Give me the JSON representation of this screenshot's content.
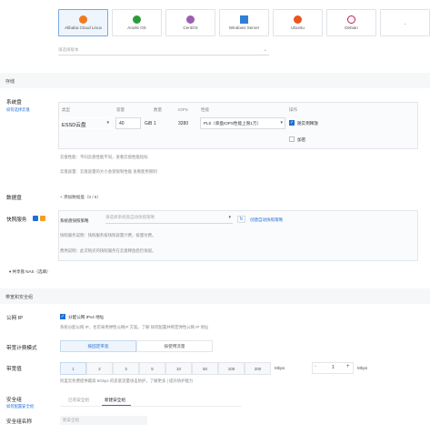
{
  "os_tabs": [
    {
      "name": "Alibaba Cloud Linux",
      "color": "#f07b1f",
      "selected": true
    },
    {
      "name": "Anolis OS",
      "color": "#2d9b3a",
      "selected": false
    },
    {
      "name": "CentOS",
      "color": "#9c5fb0",
      "selected": false
    },
    {
      "name": "Windows Server",
      "color": "#2f7fd6",
      "selected": false
    },
    {
      "name": "Ubuntu",
      "color": "#e95420",
      "selected": false
    },
    {
      "name": "Debian",
      "color": "#c7184f",
      "selected": false
    },
    {
      "name": "",
      "color": "#bbb",
      "selected": false
    }
  ],
  "version_select": {
    "placeholder": "请选择版本"
  },
  "storage": {
    "section_title": "存储",
    "system_disk_label": "系统盘",
    "system_disk_sub": "如何选择云盘",
    "headers": [
      "类型",
      "容量",
      "数量",
      "IOPS",
      "性能",
      "操作"
    ],
    "disk_type": "ESSD云盘",
    "capacity": "40",
    "unit": "GiB",
    "count": "1",
    "iops": "3280",
    "performance": "PL0（单盘IOPS性能上限1万）",
    "release_label": "随实例释放",
    "encrypt_label": "加密",
    "note1": "云盘性能：不同云盘性能不同，查看云盘性能指标",
    "note2": "云盘容量：云盘容量的大小会受限制性能 查看使用限制",
    "data_disk_label": "数据盘",
    "add_data_disk": "添加数据盘（0 / 6）",
    "snapshot_label": "快照服务",
    "snapshot_policy_label": "系统盘快照策略",
    "snapshot_policy_placeholder": "请选择系统盘自动快照策略",
    "create_policy": "创建自动快照策略",
    "snapshot_note1": "快照服务说明：快照服务按快照容量计费，按量付费。",
    "snapshot_note2": "费用说明：此次购买的快照服务在云盘释放后仍保留。",
    "shared_nas": "共享盘 NAS（选填）"
  },
  "network": {
    "section_title": "带宽和安全组",
    "public_ip_label": "公网 IP",
    "public_ip_checkbox": "分配公网 IPv4 地址",
    "public_ip_note": "系统分配公网 IP，也可采用弹性公网IP 方案。了解 如何配置并绑定弹性公网 IP 地址",
    "billing_label": "带宽计费模式",
    "billing_options": [
      "按固定带宽",
      "按使用流量"
    ],
    "bandwidth_label": "带宽值",
    "bandwidth_values": [
      "1",
      "2",
      "3",
      "5",
      "10",
      "50",
      "100",
      "200"
    ],
    "bandwidth_selected": "1",
    "bandwidth_unit": "Mbps",
    "stepper_value": "1",
    "stepper_unit": "Mbps",
    "bandwidth_note": "阿里云免费提供最高 5Gbps 的恶意流量攻击防护，了解更多 | 提升防护能力",
    "security_group_label": "安全组",
    "security_group_sub": "如何配置安全组",
    "sg_tabs": [
      "已有安全组",
      "新建安全组"
    ],
    "sg_active": "新建安全组",
    "sg_name_label": "安全组名称",
    "sg_name_placeholder": "新安全组"
  }
}
